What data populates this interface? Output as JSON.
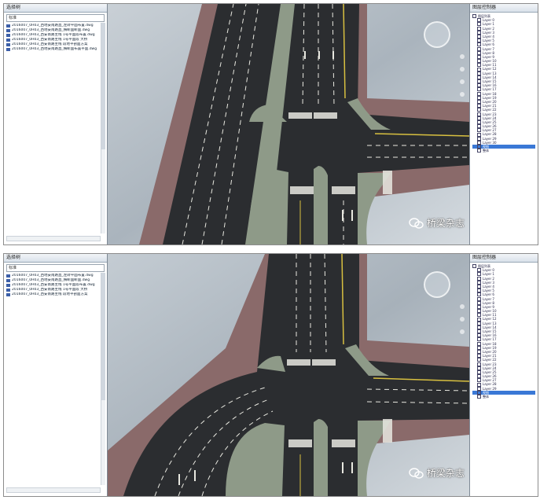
{
  "colors": {
    "asphalt": "#2b2d30",
    "median": "#8e9a88",
    "sidewalk": "#8a6a6a",
    "marking": "#e8e8e0",
    "yellow": "#d8c040",
    "panel_selected": "#3a78d6"
  },
  "top": {
    "left_panel": {
      "title": "选择树",
      "combo": "标准",
      "files": [
        "2016007_0H03_西地安南路直_左转平面布置.dwg",
        "2016007_0H03_西地安南路直_横断面断面.dwg",
        "2016007_0H03_西安南路主线   1号平面段布置.dwg",
        "2016007_0H03_西安南路主线   1号平面段    大桥",
        "2016007_0H03_西安南路主线   段地平剖面方案",
        "2016007_0H03_西地安南路直_横断面布置平面.dwg"
      ]
    },
    "right_panel": {
      "title": "图层控制器",
      "tree": [
        "图层列表",
        "Layer 0",
        "Layer 1",
        "Layer 2",
        "Layer 3",
        "Layer 4",
        "Layer 5",
        "Layer 6",
        "Layer 7",
        "Layer 8",
        "Layer 9",
        "Layer 10",
        "Layer 11",
        "Layer 12",
        "Layer 13",
        "Layer 14",
        "Layer 15",
        "Layer 16",
        "Layer 17",
        "Layer 18",
        "Layer 19",
        "Layer 20",
        "Layer 21",
        "Layer 22",
        "Layer 23",
        "Layer 24",
        "Layer 25",
        "Layer 26",
        "Layer 27",
        "Layer 28",
        "Layer 29",
        "Layer 30",
        "视图",
        "整体"
      ],
      "selected_index": 32
    },
    "watermark": "桥梁杂志"
  },
  "bottom": {
    "left_panel": {
      "title": "选择树",
      "combo": "标准",
      "files": [
        "2016007_0H03_西地安南路直_左转平面布置.dwg",
        "2016007_0H03_西地安南路直_横断面断面.dwg",
        "2016007_0H03_西安南路主线   1号平面段布置.dwg",
        "2016007_0H03_西安南路主线   1号平面段    大桥",
        "2016007_0H03_西安南路主线   段地平剖面方案"
      ]
    },
    "right_panel": {
      "title": "图层控制器",
      "tree": [
        "图层列表",
        "Layer 0",
        "Layer 1",
        "Layer 2",
        "Layer 3",
        "Layer 4",
        "Layer 5",
        "Layer 6",
        "Layer 7",
        "Layer 8",
        "Layer 9",
        "Layer 10",
        "Layer 11",
        "Layer 12",
        "Layer 13",
        "Layer 14",
        "Layer 15",
        "Layer 16",
        "Layer 17",
        "Layer 18",
        "Layer 19",
        "Layer 20",
        "Layer 21",
        "Layer 22",
        "Layer 23",
        "Layer 24",
        "Layer 25",
        "Layer 26",
        "Layer 27",
        "Layer 28",
        "Layer 29",
        "视图",
        "整体"
      ],
      "selected_index": 31
    },
    "watermark": "桥梁杂志"
  }
}
